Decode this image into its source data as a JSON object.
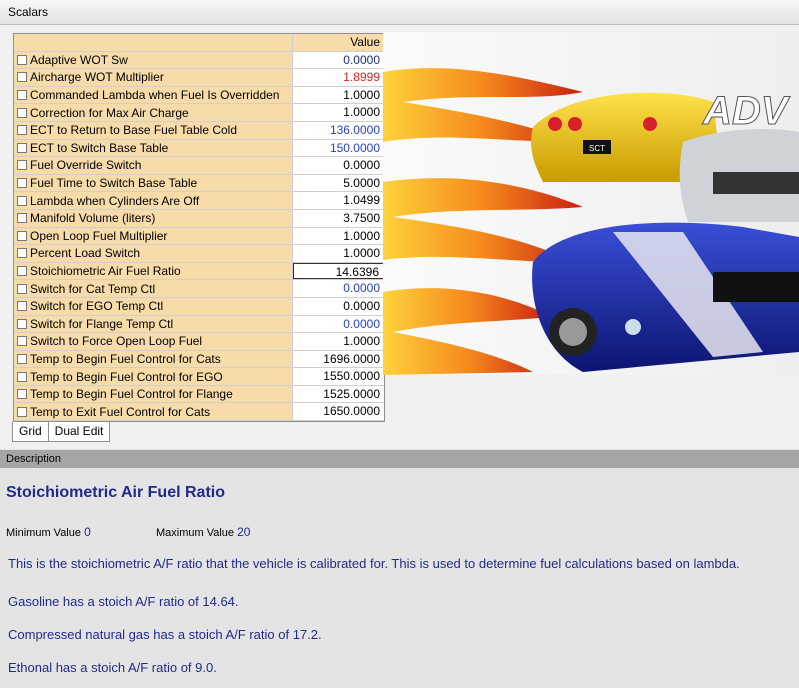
{
  "window": {
    "title": "Scalars"
  },
  "grid": {
    "header": {
      "name": "",
      "value": "Value"
    },
    "rows": [
      {
        "name": "Adaptive WOT Sw",
        "value": "0.0000",
        "color": "#1f2b8c"
      },
      {
        "name": "Aircharge WOT Multiplier",
        "value": "1.8999",
        "color": "#e02020"
      },
      {
        "name": "Commanded Lambda when Fuel Is Overridden",
        "value": "1.0000",
        "color": "#000000"
      },
      {
        "name": "Correction for Max Air Charge",
        "value": "1.0000",
        "color": "#000000"
      },
      {
        "name": "ECT to Return to Base Fuel Table Cold",
        "value": "136.0000",
        "color": "#2840c8"
      },
      {
        "name": "ECT to Switch Base Table",
        "value": "150.0000",
        "color": "#2840c8"
      },
      {
        "name": "Fuel Override Switch",
        "value": "0.0000",
        "color": "#000000"
      },
      {
        "name": "Fuel Time to Switch Base Table",
        "value": "5.0000",
        "color": "#000000"
      },
      {
        "name": "Lambda when Cylinders Are Off",
        "value": "1.0499",
        "color": "#000000"
      },
      {
        "name": "Manifold Volume (liters)",
        "value": "3.7500",
        "color": "#000000"
      },
      {
        "name": "Open Loop Fuel Multiplier",
        "value": "1.0000",
        "color": "#000000"
      },
      {
        "name": "Percent Load Switch",
        "value": "1.0000",
        "color": "#000000"
      },
      {
        "name": "Stoichiometric Air Fuel Ratio",
        "value": "14.6396",
        "color": "#000000"
      },
      {
        "name": "Switch for Cat Temp Ctl",
        "value": "0.0000",
        "color": "#2840c8"
      },
      {
        "name": "Switch for EGO Temp Ctl",
        "value": "0.0000",
        "color": "#000000"
      },
      {
        "name": "Switch for Flange Temp Ctl",
        "value": "0.0000",
        "color": "#2840c8"
      },
      {
        "name": "Switch to Force Open Loop Fuel",
        "value": "1.0000",
        "color": "#000000"
      },
      {
        "name": "Temp to Begin Fuel Control for Cats",
        "value": "1696.0000",
        "color": "#000000"
      },
      {
        "name": "Temp to Begin Fuel Control for EGO",
        "value": "1550.0000",
        "color": "#000000"
      },
      {
        "name": "Temp to Begin Fuel Control for Flange",
        "value": "1525.0000",
        "color": "#000000"
      },
      {
        "name": "Temp to Exit Fuel Control for Cats",
        "value": "1650.0000",
        "color": "#000000"
      }
    ]
  },
  "tabs": [
    "Grid",
    "Dual Edit"
  ],
  "description": {
    "bar_label": "Description",
    "title": "Stoichiometric Air Fuel Ratio",
    "min_label": "Minimum Value",
    "min_value": "0",
    "max_label": "Maximum Value",
    "max_value": "20",
    "paragraphs": [
      "This is the stoichiometric A/F ratio that the vehicle is calibrated for.  This is used to determine fuel calculations based on lambda.",
      "Gasoline has a stoich A/F ratio of 14.64.",
      "Compressed natural gas has a stoich A/F ratio of 17.2.",
      "Ethonal has a stoich A/F ratio of 9.0."
    ]
  },
  "art": {
    "logo_text": "ADV",
    "badge_text": "SCT"
  }
}
